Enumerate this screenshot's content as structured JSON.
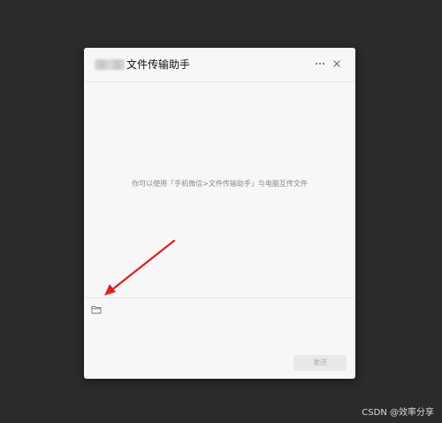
{
  "window": {
    "title": "文件传输助手",
    "more_icon": "more-horizontal-icon",
    "close_icon": "close-icon"
  },
  "chat": {
    "hint_text": "你可以使用「手机微信>文件传输助手」与电脑互传文件"
  },
  "composer": {
    "folder_icon": "folder-icon",
    "input_value": "",
    "send_label": "发送"
  },
  "annotation": {
    "arrow_color": "#e02020"
  },
  "watermark": {
    "text": "CSDN @效率分享"
  }
}
